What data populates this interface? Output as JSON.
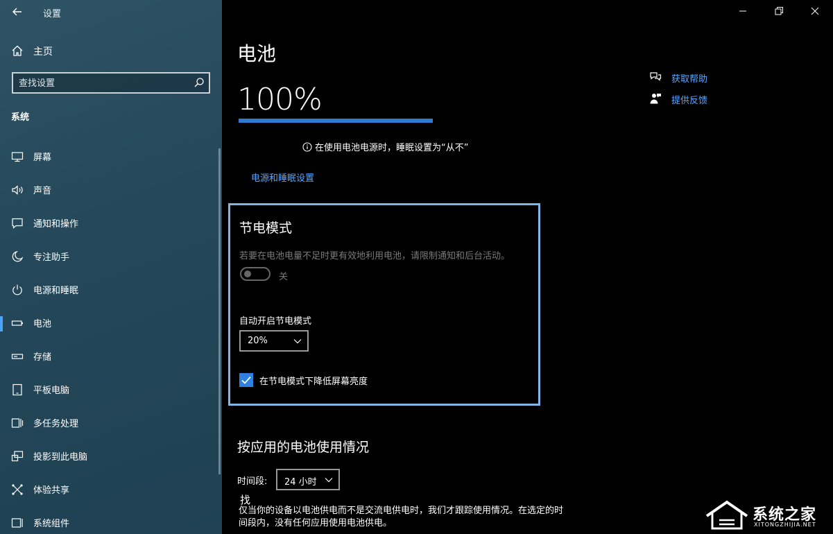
{
  "window": {
    "app_title": "设置",
    "controls": [
      "minimize",
      "restore",
      "close"
    ]
  },
  "sidebar": {
    "home_label": "主页",
    "search": {
      "placeholder": "查找设置"
    },
    "section_title": "系统",
    "items": [
      {
        "label": "屏幕",
        "icon": "monitor-icon"
      },
      {
        "label": "声音",
        "icon": "speaker-icon"
      },
      {
        "label": "通知和操作",
        "icon": "notification-icon"
      },
      {
        "label": "专注助手",
        "icon": "moon-icon"
      },
      {
        "label": "电源和睡眠",
        "icon": "power-icon"
      },
      {
        "label": "电池",
        "icon": "battery-icon",
        "active": true
      },
      {
        "label": "存储",
        "icon": "storage-icon"
      },
      {
        "label": "平板电脑",
        "icon": "tablet-icon"
      },
      {
        "label": "多任务处理",
        "icon": "multitask-icon"
      },
      {
        "label": "投影到此电脑",
        "icon": "project-icon"
      },
      {
        "label": "体验共享",
        "icon": "share-icon"
      },
      {
        "label": "系统组件",
        "icon": "components-icon"
      }
    ]
  },
  "main": {
    "title": "电池",
    "battery_percent_label": "100%",
    "battery_level": 1.0,
    "sleep_note": "在使用电池电源时，睡眠设置为“从不”",
    "power_link": "电源和睡眠设置",
    "help": {
      "get_help": "获取帮助",
      "feedback": "提供反馈"
    },
    "saver": {
      "title": "节电模式",
      "description": "若要在电池电量不足时更有效地利用电池，请限制通知和后台活动。",
      "toggle_state": "关",
      "auto_label": "自动开启节电模式",
      "auto_value": "20%",
      "checkbox_label": "在节电模式下降低屏幕亮度",
      "checkbox_checked": true
    },
    "usage": {
      "title": "按应用的电池使用情况",
      "period_label": "时间段:",
      "period_value": "24 小时",
      "stub": "找",
      "description": "仅当你的设备以电池供电而不是交流电供电时，我们才跟踪使用情况。在选定的时间段内，没有任何应用使用电池供电。"
    }
  },
  "watermark": {
    "main": "系统之家",
    "sub": "XITONGZHIJIA.NET"
  },
  "colors": {
    "accent": "#2f7bd1",
    "link": "#5aa8ff",
    "highlight_border": "#7fb6e6",
    "sidebar_bg": "#24485a"
  }
}
